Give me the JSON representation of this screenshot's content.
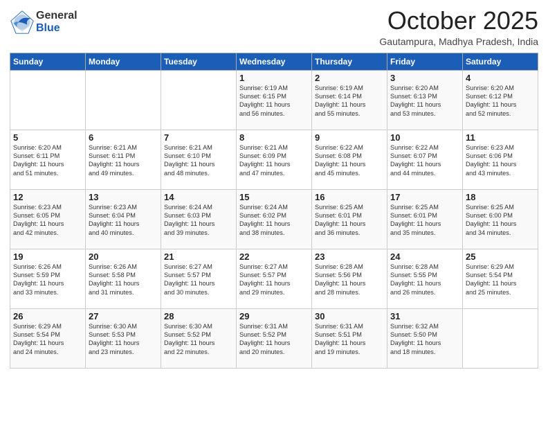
{
  "header": {
    "logo_general": "General",
    "logo_blue": "Blue",
    "month_title": "October 2025",
    "location": "Gautampura, Madhya Pradesh, India"
  },
  "weekdays": [
    "Sunday",
    "Monday",
    "Tuesday",
    "Wednesday",
    "Thursday",
    "Friday",
    "Saturday"
  ],
  "weeks": [
    [
      {
        "day": "",
        "info": ""
      },
      {
        "day": "",
        "info": ""
      },
      {
        "day": "",
        "info": ""
      },
      {
        "day": "1",
        "info": "Sunrise: 6:19 AM\nSunset: 6:15 PM\nDaylight: 11 hours\nand 56 minutes."
      },
      {
        "day": "2",
        "info": "Sunrise: 6:19 AM\nSunset: 6:14 PM\nDaylight: 11 hours\nand 55 minutes."
      },
      {
        "day": "3",
        "info": "Sunrise: 6:20 AM\nSunset: 6:13 PM\nDaylight: 11 hours\nand 53 minutes."
      },
      {
        "day": "4",
        "info": "Sunrise: 6:20 AM\nSunset: 6:12 PM\nDaylight: 11 hours\nand 52 minutes."
      }
    ],
    [
      {
        "day": "5",
        "info": "Sunrise: 6:20 AM\nSunset: 6:11 PM\nDaylight: 11 hours\nand 51 minutes."
      },
      {
        "day": "6",
        "info": "Sunrise: 6:21 AM\nSunset: 6:11 PM\nDaylight: 11 hours\nand 49 minutes."
      },
      {
        "day": "7",
        "info": "Sunrise: 6:21 AM\nSunset: 6:10 PM\nDaylight: 11 hours\nand 48 minutes."
      },
      {
        "day": "8",
        "info": "Sunrise: 6:21 AM\nSunset: 6:09 PM\nDaylight: 11 hours\nand 47 minutes."
      },
      {
        "day": "9",
        "info": "Sunrise: 6:22 AM\nSunset: 6:08 PM\nDaylight: 11 hours\nand 45 minutes."
      },
      {
        "day": "10",
        "info": "Sunrise: 6:22 AM\nSunset: 6:07 PM\nDaylight: 11 hours\nand 44 minutes."
      },
      {
        "day": "11",
        "info": "Sunrise: 6:23 AM\nSunset: 6:06 PM\nDaylight: 11 hours\nand 43 minutes."
      }
    ],
    [
      {
        "day": "12",
        "info": "Sunrise: 6:23 AM\nSunset: 6:05 PM\nDaylight: 11 hours\nand 42 minutes."
      },
      {
        "day": "13",
        "info": "Sunrise: 6:23 AM\nSunset: 6:04 PM\nDaylight: 11 hours\nand 40 minutes."
      },
      {
        "day": "14",
        "info": "Sunrise: 6:24 AM\nSunset: 6:03 PM\nDaylight: 11 hours\nand 39 minutes."
      },
      {
        "day": "15",
        "info": "Sunrise: 6:24 AM\nSunset: 6:02 PM\nDaylight: 11 hours\nand 38 minutes."
      },
      {
        "day": "16",
        "info": "Sunrise: 6:25 AM\nSunset: 6:01 PM\nDaylight: 11 hours\nand 36 minutes."
      },
      {
        "day": "17",
        "info": "Sunrise: 6:25 AM\nSunset: 6:01 PM\nDaylight: 11 hours\nand 35 minutes."
      },
      {
        "day": "18",
        "info": "Sunrise: 6:25 AM\nSunset: 6:00 PM\nDaylight: 11 hours\nand 34 minutes."
      }
    ],
    [
      {
        "day": "19",
        "info": "Sunrise: 6:26 AM\nSunset: 5:59 PM\nDaylight: 11 hours\nand 33 minutes."
      },
      {
        "day": "20",
        "info": "Sunrise: 6:26 AM\nSunset: 5:58 PM\nDaylight: 11 hours\nand 31 minutes."
      },
      {
        "day": "21",
        "info": "Sunrise: 6:27 AM\nSunset: 5:57 PM\nDaylight: 11 hours\nand 30 minutes."
      },
      {
        "day": "22",
        "info": "Sunrise: 6:27 AM\nSunset: 5:57 PM\nDaylight: 11 hours\nand 29 minutes."
      },
      {
        "day": "23",
        "info": "Sunrise: 6:28 AM\nSunset: 5:56 PM\nDaylight: 11 hours\nand 28 minutes."
      },
      {
        "day": "24",
        "info": "Sunrise: 6:28 AM\nSunset: 5:55 PM\nDaylight: 11 hours\nand 26 minutes."
      },
      {
        "day": "25",
        "info": "Sunrise: 6:29 AM\nSunset: 5:54 PM\nDaylight: 11 hours\nand 25 minutes."
      }
    ],
    [
      {
        "day": "26",
        "info": "Sunrise: 6:29 AM\nSunset: 5:54 PM\nDaylight: 11 hours\nand 24 minutes."
      },
      {
        "day": "27",
        "info": "Sunrise: 6:30 AM\nSunset: 5:53 PM\nDaylight: 11 hours\nand 23 minutes."
      },
      {
        "day": "28",
        "info": "Sunrise: 6:30 AM\nSunset: 5:52 PM\nDaylight: 11 hours\nand 22 minutes."
      },
      {
        "day": "29",
        "info": "Sunrise: 6:31 AM\nSunset: 5:52 PM\nDaylight: 11 hours\nand 20 minutes."
      },
      {
        "day": "30",
        "info": "Sunrise: 6:31 AM\nSunset: 5:51 PM\nDaylight: 11 hours\nand 19 minutes."
      },
      {
        "day": "31",
        "info": "Sunrise: 6:32 AM\nSunset: 5:50 PM\nDaylight: 11 hours\nand 18 minutes."
      },
      {
        "day": "",
        "info": ""
      }
    ]
  ]
}
